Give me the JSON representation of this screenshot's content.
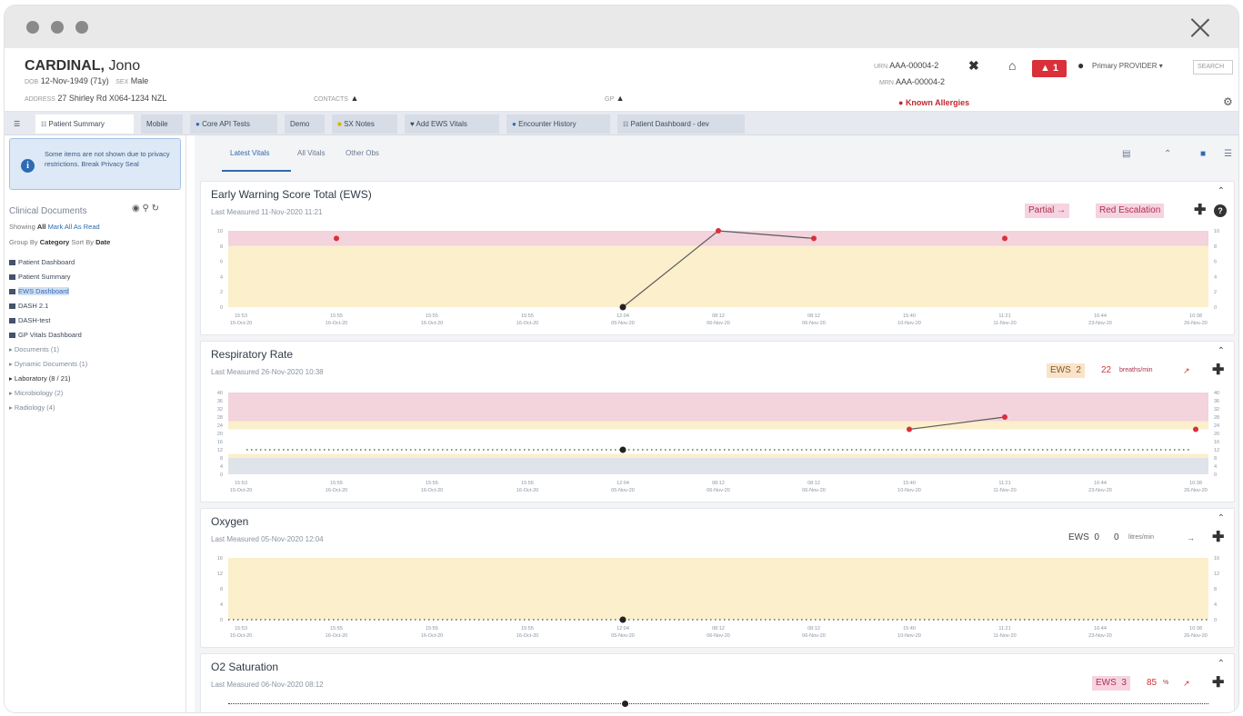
{
  "window": {
    "controls": [
      "close",
      "minimize",
      "maximize"
    ]
  },
  "patient": {
    "surname": "CARDINAL,",
    "given": "Jono",
    "dob_label": "DOB",
    "dob": "12-Nov-1949 (71y)",
    "sex_label": "SEX",
    "sex": "Male",
    "address_label": "ADDRESS",
    "address": "27 Shirley Rd X064-1234 NZL",
    "contacts_label": "CONTACTS",
    "urn_label": "URN",
    "urn": "AAA-00004-2",
    "mrn_label": "MRN",
    "mrn": "AAA-00004-2",
    "allergies": "Known Allergies",
    "alerts_count": "1",
    "provider": "Primary PROVIDER",
    "search_placeholder": "SEARCH"
  },
  "tabs": [
    {
      "label": "Patient Summary",
      "active": true
    },
    {
      "label": "Mobile",
      "active": false
    },
    {
      "label": "Core API Tests",
      "active": false
    },
    {
      "label": "Demo",
      "active": false
    },
    {
      "label": "SX Notes",
      "active": false
    },
    {
      "label": "Add EWS Vitals",
      "active": false
    },
    {
      "label": "Encounter History",
      "active": false
    },
    {
      "label": "Patient Dashboard - dev",
      "active": false
    }
  ],
  "sidebar": {
    "info": "Some items are not shown due to privacy restrictions. Break Privacy Seal",
    "heading": "Clinical Documents",
    "showing_label": "Showing",
    "showing_value": "All",
    "mark_read": "Mark All As Read",
    "group_label": "Group By",
    "group_value": "Category",
    "sort_label": "Sort By",
    "sort_value": "Date",
    "items": [
      "Patient Dashboard",
      "Patient Summary",
      "EWS Dashboard",
      "DASH 2.1",
      "DASH-test",
      "GP Vitals Dashboard"
    ],
    "tree": [
      "Documents (1)",
      "Dynamic Documents (1)",
      "Laboratory (8 / 21)",
      "Microbiology (2)",
      "Radiology (4)"
    ]
  },
  "subtabs": [
    "Latest Vitals",
    "All Vitals",
    "Other Obs"
  ],
  "panels": [
    {
      "title": "Early Warning Score Total (EWS)",
      "last": "Last Measured 11-Nov-2020 11:21",
      "badges": [
        {
          "text": "Partial",
          "arrow": "→",
          "bg": "#f6d3e0",
          "color": "#b0304f"
        },
        {
          "text": "Red Escalation",
          "bg": "#f6d3e0",
          "color": "#b0304f"
        }
      ]
    },
    {
      "title": "Respiratory Rate",
      "last": "Last Measured 26-Nov-2020 10:38",
      "ews": "EWS",
      "ews_value": "2",
      "value": "22",
      "unit": "breaths/min"
    },
    {
      "title": "Oxygen",
      "last": "Last Measured 05-Nov-2020 12:04",
      "ews": "EWS",
      "ews_value": "0",
      "value": "0",
      "unit": "litres/min"
    },
    {
      "title": "O2 Saturation",
      "last": "Last Measured 06-Nov-2020 08:12",
      "ews": "EWS",
      "ews_value": "3",
      "value": "85",
      "unit": "%"
    }
  ],
  "chart_data": [
    {
      "type": "line",
      "title": "Early Warning Score Total (EWS)",
      "x": [
        "15-Oct-20 15:53",
        "16-Oct-20 15:55",
        "16-Oct-20 15:55",
        "16-Oct-20 15:55",
        "05-Nov-20 12:04",
        "06-Nov-20 08:12",
        "06-Nov-20 08:12",
        "10-Nov-20 15:40",
        "11-Nov-20 11:21",
        "23-Nov-20 16:44",
        "26-Nov-20 10:38"
      ],
      "series": [
        {
          "values": [
            null,
            9,
            null,
            null,
            0,
            10,
            9,
            null,
            9,
            null,
            null
          ]
        }
      ],
      "ylim": [
        0,
        10
      ],
      "ticks": [
        0,
        2,
        4,
        6,
        8,
        10
      ],
      "colors": {
        "red": "#f3d3dc",
        "yellow": "#fbefcc",
        "line": "#5a5a5a",
        "point": "#d9303a"
      }
    },
    {
      "type": "line",
      "title": "Respiratory Rate",
      "x": [
        "15-Oct-20 15:53",
        "16-Oct-20 15:55",
        "16-Oct-20 15:55",
        "16-Oct-20 15:55",
        "05-Nov-20 12:04",
        "06-Nov-20 08:12",
        "06-Nov-20 08:12",
        "10-Nov-20 15:40",
        "11-Nov-20 11:21",
        "23-Nov-20 16:44",
        "26-Nov-20 10:38"
      ],
      "series": [
        {
          "values": [
            null,
            null,
            null,
            null,
            12,
            null,
            null,
            22,
            28,
            null,
            22
          ]
        }
      ],
      "ylim": [
        0,
        40
      ],
      "ticks": [
        0,
        4,
        8,
        12,
        16,
        20,
        24,
        28,
        32,
        36,
        40
      ],
      "colors": {
        "red": "#f3d3dc",
        "yellow": "#fbefcc",
        "line": "#5a5a5a",
        "point": "#d9303a"
      }
    },
    {
      "type": "line",
      "title": "Oxygen",
      "x": [
        "15-Oct-20 15:53",
        "16-Oct-20 15:55",
        "16-Oct-20 15:55",
        "16-Oct-20 15:55",
        "05-Nov-20 12:04",
        "06-Nov-20 08:12",
        "06-Nov-20 08:12",
        "10-Nov-20 15:40",
        "11-Nov-20 11:21",
        "23-Nov-20 16:44",
        "26-Nov-20 10:38"
      ],
      "series": [
        {
          "values": [
            null,
            null,
            null,
            null,
            0,
            null,
            null,
            null,
            null,
            null,
            null
          ]
        }
      ],
      "ylim": [
        0,
        16
      ],
      "ticks": [
        0,
        4,
        8,
        12,
        16
      ],
      "colors": {
        "yellow": "#fbefcc",
        "point": "#222222"
      }
    }
  ]
}
